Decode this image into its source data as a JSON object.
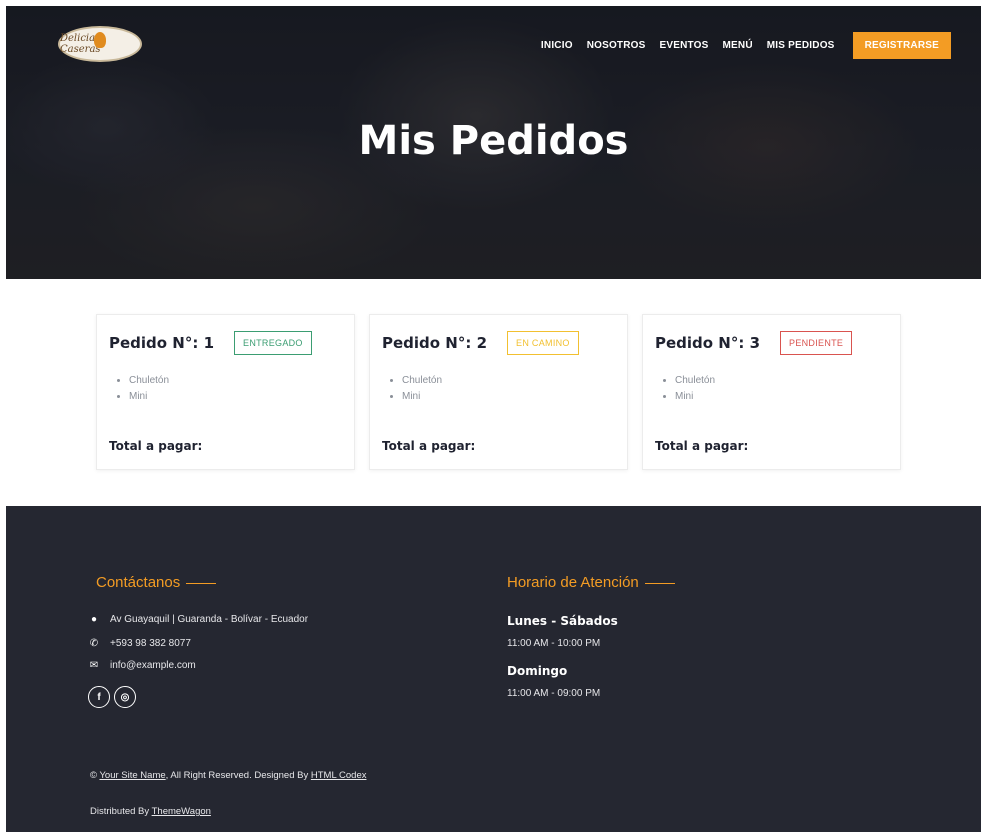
{
  "nav": {
    "items": [
      "INICIO",
      "NOSOTROS",
      "EVENTOS",
      "MENÚ",
      "MIS PEDIDOS"
    ],
    "register": "REGISTRARSE",
    "logo_text": "Delicias Caseras"
  },
  "hero": {
    "title": "Mis Pedidos"
  },
  "orders": [
    {
      "title": "Pedido N°: 1",
      "status": "ENTREGADO",
      "items": [
        "Chuletón",
        "Mini"
      ],
      "total_label": "Total a pagar:"
    },
    {
      "title": "Pedido N°: 2",
      "status": "EN CAMINO",
      "items": [
        "Chuletón",
        "Mini"
      ],
      "total_label": "Total a pagar:"
    },
    {
      "title": "Pedido N°: 3",
      "status": "PENDIENTE",
      "items": [
        "Chuletón",
        "Mini"
      ],
      "total_label": "Total a pagar:"
    }
  ],
  "footer": {
    "contact_title": "Contáctanos",
    "address": "Av Guayaquil | Guaranda - Bolívar - Ecuador",
    "phone": "+593 98 382 8077",
    "email": "info@example.com",
    "hours_title": "Horario de Atención",
    "weekday_label": "Lunes - Sábados",
    "weekday_hours": "11:00 AM - 10:00 PM",
    "sunday_label": "Domingo",
    "sunday_hours": "11:00 AM - 09:00 PM",
    "copyright_prefix": "© ",
    "site_name": "Your Site Name",
    "copyright_mid": ", All Right Reserved. Designed By ",
    "designer": "HTML Codex",
    "distributed_prefix": "Distributed By ",
    "distributor": "ThemeWagon"
  },
  "colors": {
    "accent": "#f39c24",
    "footer_bg": "#252731",
    "delivered": "#3b9d72",
    "on_way": "#f2c030",
    "pending": "#d9534f"
  }
}
